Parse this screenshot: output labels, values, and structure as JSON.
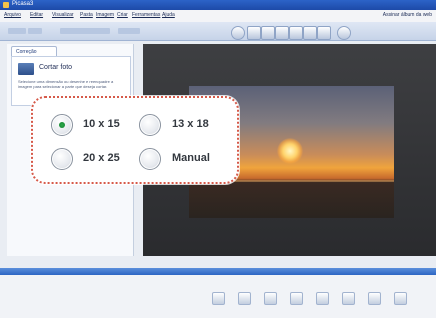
{
  "window": {
    "title": "Picasa3"
  },
  "menu": {
    "items": [
      "Arquivo",
      "Editar",
      "Visualizar",
      "Pasta",
      "Imagem",
      "Criar",
      "Ferramentas",
      "Ajuda"
    ],
    "right_link": "Assinar álbum da web"
  },
  "sidebar": {
    "tab_label": "Correção",
    "crop_title": "Cortar foto",
    "crop_description": "Selecione uma dimensão ou desenhe e reenquadre a imagem para selecionar a parte que deseja cortar."
  },
  "crop_options": {
    "options": [
      "10 x 15",
      "13 x 18",
      "20 x 25",
      "Manual"
    ],
    "selected": "10 x 15"
  },
  "colors": {
    "accent": "#d65a4a",
    "selected_radio": "#1f9a3c",
    "titlebar": "#2c63c8"
  },
  "icons": [
    "app-icon",
    "crop-icon",
    "rotate-left-icon",
    "rotate-right-icon",
    "radio-selected-icon",
    "radio-unselected-icon"
  ]
}
